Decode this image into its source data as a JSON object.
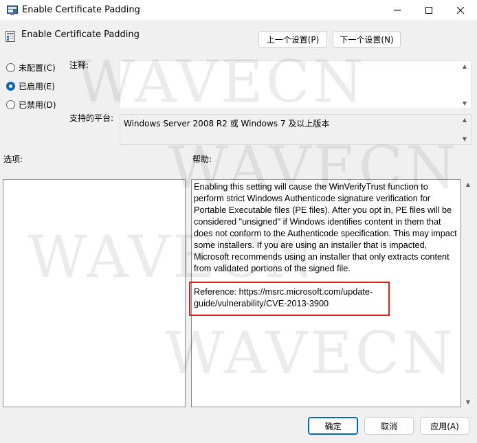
{
  "window": {
    "title": "Enable Certificate Padding"
  },
  "header": {
    "policy_name": "Enable Certificate Padding",
    "prev_button": "上一个设置(P)",
    "next_button": "下一个设置(N)"
  },
  "state_options": [
    {
      "label": "未配置(C)",
      "checked": false
    },
    {
      "label": "已启用(E)",
      "checked": true
    },
    {
      "label": "已禁用(D)",
      "checked": false
    }
  ],
  "comment": {
    "label": "注释:",
    "value": ""
  },
  "platform": {
    "label": "支持的平台:",
    "value": "Windows Server 2008 R2 或 Windows 7 及以上版本"
  },
  "options_panel": {
    "label": "选项:"
  },
  "help_panel": {
    "label": "帮助:",
    "body": "Enabling this setting will cause the WinVerifyTrust function to perform strict Windows Authenticode signature verification for Portable Executable files (PE files). After you opt in, PE files will be considered \"unsigned\" if Windows identifies content in them that does not conform to the Authenticode specification. This may impact some installers. If you are using an installer that is impacted, Microsoft recommends using an installer that only extracts content from validated portions of the signed file.",
    "reference": "Reference: https://msrc.microsoft.com/update-guide/vulnerability/CVE-2013-3900"
  },
  "footer": {
    "ok": "确定",
    "cancel": "取消",
    "apply": "应用(A)"
  },
  "watermark": {
    "text": "WAVECN"
  },
  "colors": {
    "accent": "#0067c0",
    "highlight": "#e02020"
  },
  "icons": [
    "policy-icon",
    "minimize-icon",
    "maximize-icon",
    "close-icon",
    "scroll-up-icon",
    "scroll-down-icon"
  ]
}
